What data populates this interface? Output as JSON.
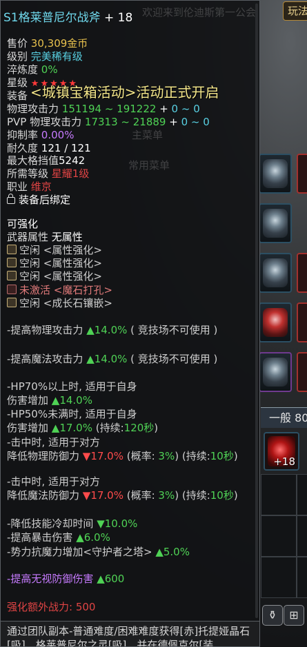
{
  "scene": {
    "top_button_label": "玩法",
    "general_tab_label": "一般 80",
    "bag_item_count": "+18",
    "bottom_icon_glyph": "⊞"
  },
  "ghost_text": {
    "guild_note": "欢迎来到伦迪斯第一公会",
    "main_menu": "主菜单",
    "common_menu": "常用菜单"
  },
  "item": {
    "name": "S1格莱普尼尔战斧",
    "enhance": "+ 18",
    "price_label": "售价",
    "price_value": "30,309金币",
    "grade_label": "级别",
    "grade_value": "完美稀有级",
    "quench_label": "淬炼度",
    "quench_value": "0%",
    "star_label": "星级",
    "stars": "★★★★★",
    "equip_label": "装备",
    "phys_atk_label": "物理攻击力",
    "phys_atk_range": "151194 ~ 191222",
    "phys_atk_bonus_plus": " + ",
    "phys_atk_bonus": "0 ~ 0",
    "pvp_atk_label": "PVP 物理攻击力",
    "pvp_atk_range": "17313 ~ 21889",
    "pvp_atk_bonus_plus": " + ",
    "pvp_atk_bonus": "0 ~ 0",
    "suppress_label": "抑制率",
    "suppress_value": "0.00%",
    "durability_label": "耐久度",
    "durability_value": "121 / 121",
    "max_block_label": "最大格挡值",
    "max_block_value": "5242",
    "req_level_label": "所需等级",
    "req_level_value": "星耀1级",
    "job_label": "职业",
    "job_value": "维京",
    "bind_text": "装备后绑定"
  },
  "marquee": "<城镇宝箱活动>活动正式开启",
  "enhance": {
    "header": "可强化",
    "weapon_attr_label": "武器属性",
    "weapon_attr_value": "无属性",
    "slots": [
      {
        "label": "空闲 <属性强化>"
      },
      {
        "label": "空闲 <属性强化>"
      },
      {
        "label": "空闲 <属性强化>"
      },
      {
        "label": "未激活 <魔石打孔>"
      },
      {
        "label": "空闲 <成长石镶嵌>"
      }
    ]
  },
  "effects": {
    "e1_pre": "-提高物理攻击力 ",
    "e1_val": "▲14.0%",
    "e1_post": "( 竞技场不可使用 )",
    "e2_pre": "-提高魔法攻击力 ",
    "e2_val": "▲14.0%",
    "e2_post": "( 竞技场不可使用 )",
    "e3_line1": "-HP70%以上时, 适用于自身",
    "e3_pre": " 伤害增加 ",
    "e3_val": "▲14.0%",
    "e4_line1": "-HP50%未满时, 适用于自身",
    "e4_pre": " 伤害增加 ",
    "e4_val": "▲17.0%",
    "e4_post": " (持续:",
    "e4_dur": "120秒",
    "e4_end": ")",
    "e5_line1": "-击中时, 适用于对方",
    "e5_pre": " 降低物理防御力 ",
    "e5_val": "▼17.0%",
    "e5_mid": " (概率: ",
    "e5_prob": "3%",
    "e5_post": ") (持续:",
    "e5_dur": "10秒",
    "e5_end": ")",
    "e6_line1": "-击中时, 适用于对方",
    "e6_pre": " 降低魔法防御力 ",
    "e6_val": "▼17.0%",
    "e6_mid": " (概率: ",
    "e6_prob": "3%",
    "e6_post": ") (持续:",
    "e6_dur": "10秒",
    "e6_end": ")",
    "e7_pre": "-降低技能冷却时间 ",
    "e7_val": "▼10.0%",
    "e8_pre": "-提高暴击伤害 ",
    "e8_val": "▲6.0%",
    "e9_pre": "-势力抗魔力增加<守护者之塔> ",
    "e9_val": "▲5.0%",
    "e10_pre": "-提高无视防御伤害 ",
    "e10_val": "▲600",
    "combat_power": "强化额外战力: 500"
  },
  "footer_text": "通过团队副本-普通难度/困难难度获得[赤]托提娅晶石[吸]、格莱普尼尔之灵[吸]，并在德佩克尔[装"
}
